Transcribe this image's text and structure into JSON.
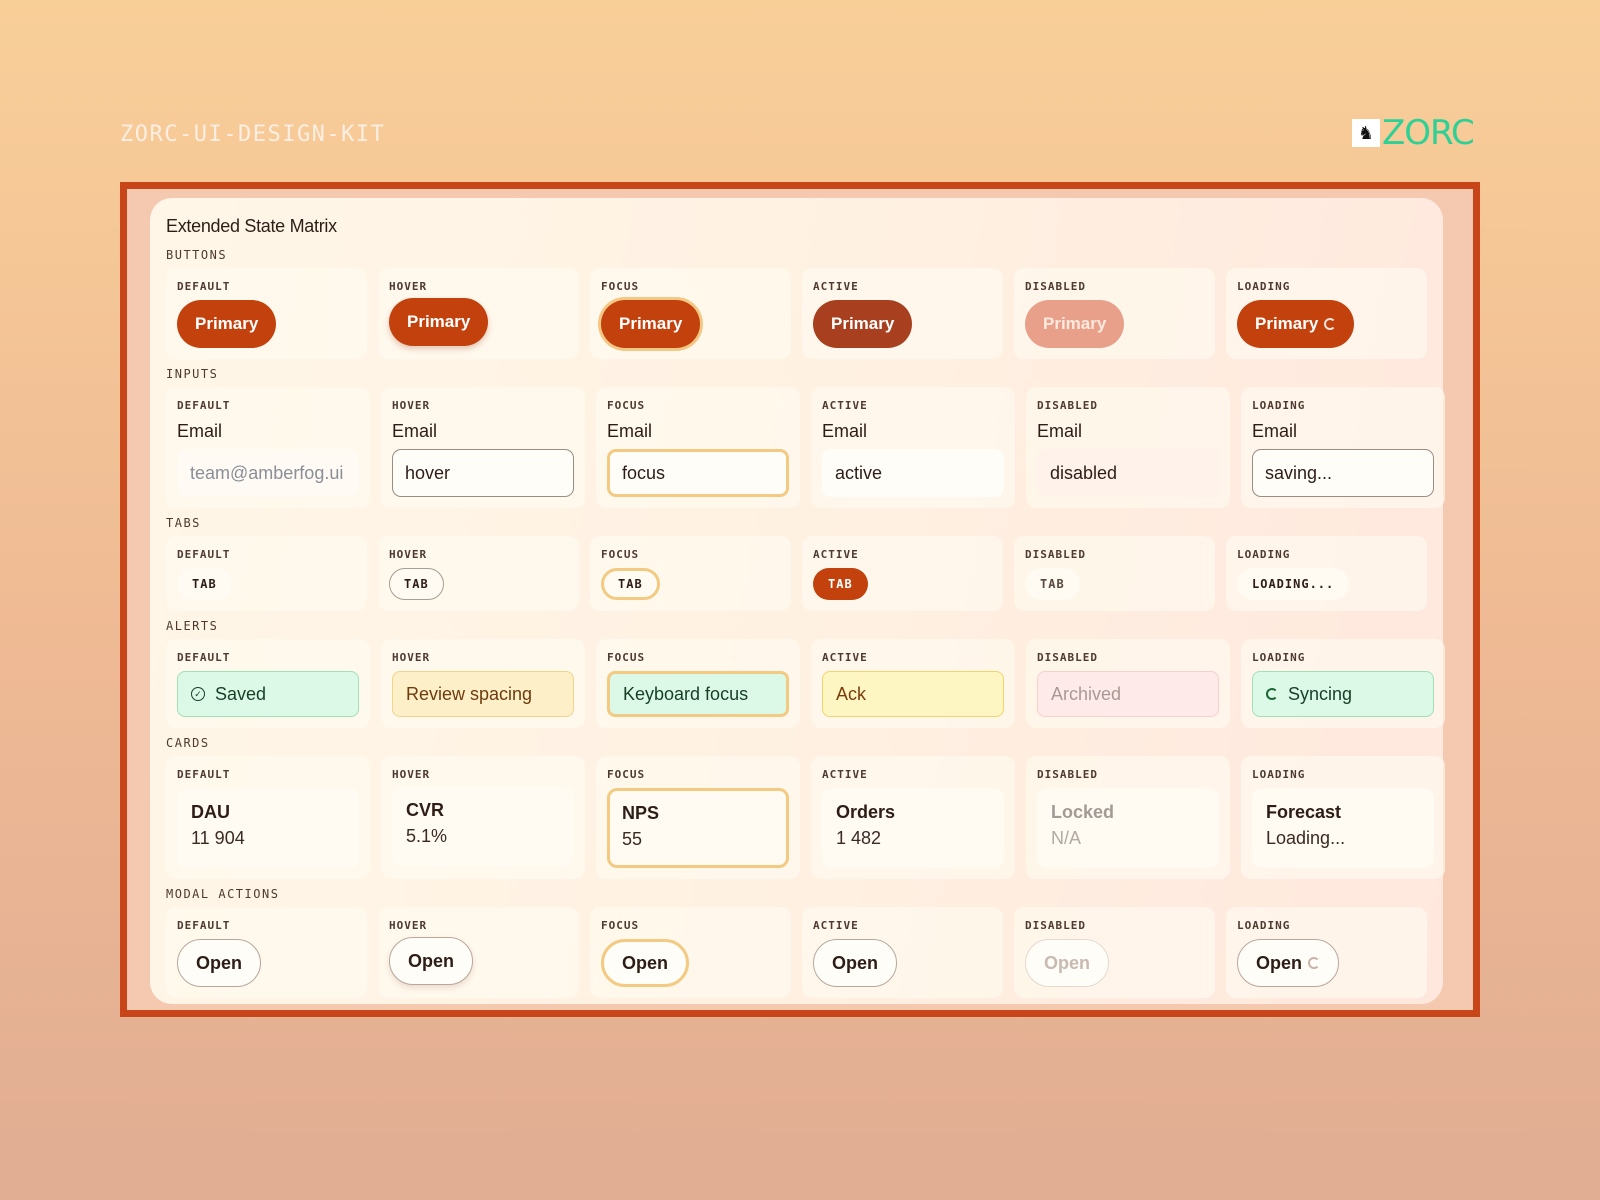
{
  "header": {
    "kit_title": "ZORC-UI-DESIGN-KIT",
    "brand_name": "ZORC",
    "brand_icon": "zorc-mascot-icon"
  },
  "colors": {
    "accent": "#c2410c",
    "brand": "#2ed095",
    "frame": "#c8451a",
    "focus_ring": "#f3ca82"
  },
  "matrix": {
    "title": "Extended State Matrix",
    "states": [
      "DEFAULT",
      "HOVER",
      "FOCUS",
      "ACTIVE",
      "DISABLED",
      "LOADING"
    ],
    "buttons": {
      "label": "BUTTONS",
      "button_text": "Primary"
    },
    "inputs": {
      "label": "INPUTS",
      "field_label": "Email",
      "values": [
        "",
        "hover",
        "focus",
        "active",
        "disabled",
        "saving..."
      ],
      "placeholder": "team@amberfog.ui"
    },
    "tabs": {
      "label": "TABS",
      "tab_text": "TAB",
      "loading_text": "LOADING..."
    },
    "alerts": {
      "label": "ALERTS",
      "texts": [
        "Saved",
        "Review spacing",
        "Keyboard focus",
        "Ack",
        "Archived",
        "Syncing"
      ]
    },
    "cards": {
      "label": "CARDS",
      "items": [
        {
          "title": "DAU",
          "value": "11 904"
        },
        {
          "title": "CVR",
          "value": "5.1%"
        },
        {
          "title": "NPS",
          "value": "55"
        },
        {
          "title": "Orders",
          "value": "1 482"
        },
        {
          "title": "Locked",
          "value": "N/A"
        },
        {
          "title": "Forecast",
          "value": "Loading..."
        }
      ]
    },
    "modal_actions": {
      "label": "MODAL ACTIONS",
      "button_text": "Open"
    }
  }
}
